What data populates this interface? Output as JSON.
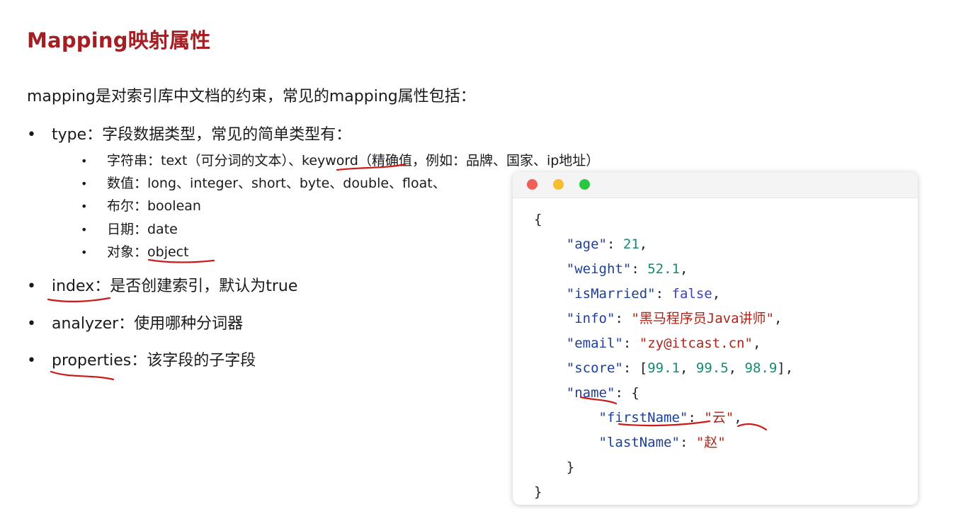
{
  "header": {
    "title": "Mapping映射属性"
  },
  "intro": "mapping是对索引库中文档的约束，常见的mapping属性包括：",
  "bullet_symbol": "•",
  "items": {
    "type": {
      "key": "type",
      "desc": "：字段数据类型，常见的简单类型有："
    },
    "index": {
      "key": "index",
      "desc": "：是否创建索引，默认为true"
    },
    "analyzer": {
      "key": "analyzer",
      "desc": "：使用哪种分词器"
    },
    "properties": {
      "key": "properties",
      "desc": "：该字段的子字段"
    }
  },
  "type_subitems": {
    "string": {
      "label": "字符串：text（可分词的文本）、",
      "keyword": "keyword",
      "rest": "（精确值，例如：品牌、国家、ip地址）"
    },
    "number": {
      "label": "数值：long、integer、short、byte、double、float、"
    },
    "boolean": {
      "label": "布尔：boolean"
    },
    "date": {
      "label": "日期：date"
    },
    "object": {
      "label": "对象：",
      "value": "object"
    }
  },
  "code_window": {
    "colors": {
      "red": "#ee5f57",
      "yellow": "#f5bd2f",
      "green": "#28c840"
    },
    "punct": {
      "open": "{",
      "close": "}",
      "colon": ": ",
      "comma": ",",
      "quote": "\"",
      "array_open": "[",
      "array_close": "]",
      "array_sep": ", ",
      "space": " "
    },
    "fields": {
      "age": {
        "key": "age",
        "value": "21"
      },
      "weight": {
        "key": "weight",
        "value": "52.1"
      },
      "isMarried": {
        "key": "isMarried",
        "value": "false"
      },
      "info": {
        "key": "info",
        "value": "黑马程序员Java讲师"
      },
      "email": {
        "key": "email",
        "value": "zy@itcast.cn"
      },
      "score": {
        "key": "score",
        "values": [
          "99.1",
          "99.5",
          "98.9"
        ]
      },
      "name": {
        "key": "name",
        "firstName": {
          "key": "firstName",
          "value": "云"
        },
        "lastName": {
          "key": "lastName",
          "value": "赵"
        }
      }
    }
  }
}
